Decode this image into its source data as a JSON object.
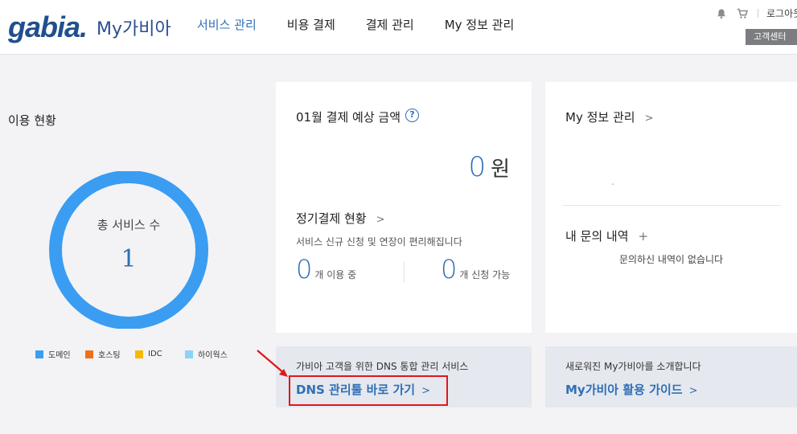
{
  "header": {
    "logo": "gabia.",
    "logo_sub": "My가비아",
    "nav": [
      "서비스 관리",
      "비용 결제",
      "결제 관리",
      "My 정보 관리"
    ],
    "logout": "로그아웃",
    "customer_center": "고객센터"
  },
  "usage": {
    "title": "이용 현황",
    "total_label": "총 서비스 수",
    "total_value": "1",
    "legend": [
      {
        "label": "도메인",
        "color": "#3a9df2"
      },
      {
        "label": "호스팅",
        "color": "#f36f16"
      },
      {
        "label": "IDC",
        "color": "#f6b900"
      },
      {
        "label": "하이웍스",
        "color": "#8ad3f7"
      }
    ]
  },
  "billing": {
    "title": "01월 결제 예상 금액",
    "amount": "0",
    "unit": "원",
    "regular_title": "정기결제 현황",
    "regular_desc": "서비스 신규 신청 및 연장이 편리해집니다",
    "in_use_count": "0",
    "in_use_label": "개 이용 중",
    "available_count": "0",
    "available_label": "개 신청 가능"
  },
  "my_info": {
    "title": "My 정보 관리",
    "dash": "-",
    "inquiry_title": "내 문의 내역",
    "inquiry_empty": "문의하신 내역이 없습니다"
  },
  "banners": {
    "dns_desc": "가비아 고객을 위한 DNS 통합 관리 서비스",
    "dns_link": "DNS 관리툴 바로 가기",
    "guide_desc": "새로워진 My가비아를 소개합니다",
    "guide_link": "My가비아 활용 가이드"
  },
  "colors": {
    "accent": "#2f6fb6",
    "donut": "#3a9df2",
    "highlight": "#e0161b"
  }
}
